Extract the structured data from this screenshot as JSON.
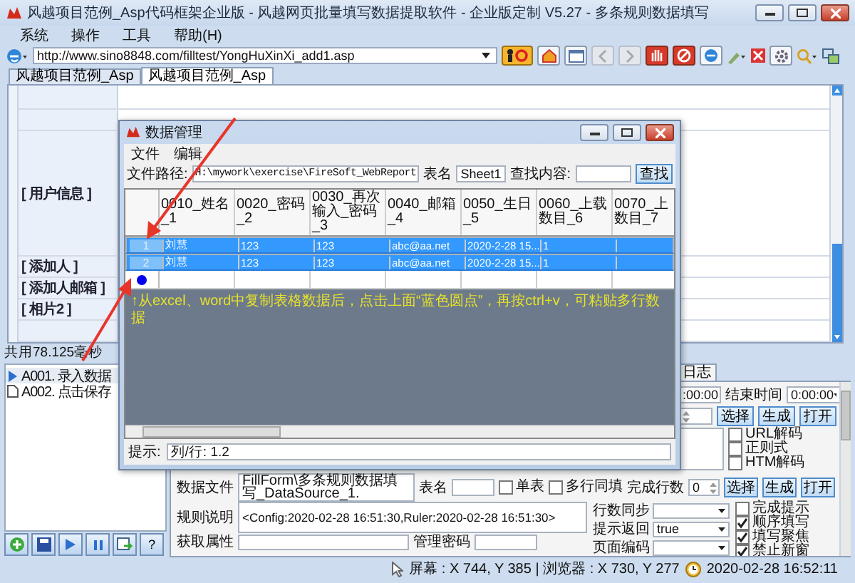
{
  "window": {
    "title": "风越项目范例_Asp代码框架企业版 - 风越网页批量填写数据提取软件 - 企业版定制 V5.27 - 多条规则数据填写"
  },
  "menu": [
    "系统",
    "操作",
    "工具",
    "帮助(H)"
  ],
  "address_bar": {
    "url": "http://www.sino8848.com/filltest/YongHuXinXi_add1.asp"
  },
  "tabs": [
    {
      "label": "风越项目范例_Asp",
      "selected": false
    },
    {
      "label": "风越项目范例_Asp",
      "selected": true
    }
  ],
  "web_form": {
    "rows": [
      {
        "kind": "blank"
      },
      {
        "kind": "blank"
      },
      {
        "kind": "section",
        "label": "[ 用户信息 ]"
      },
      {
        "kind": "field",
        "label": "[ 添加人 ]"
      },
      {
        "kind": "field",
        "label": "[ 添加人邮箱 ]"
      },
      {
        "kind": "field",
        "label": "[ 相片2 ]"
      },
      {
        "kind": "blank"
      }
    ]
  },
  "timing": "共用78.125毫秒",
  "steps": [
    {
      "label": "A001. 录入数据",
      "selected": true,
      "kind": "play"
    },
    {
      "label": "A002. 点击保存",
      "selected": false,
      "kind": "doc"
    }
  ],
  "step_buttons": [
    {
      "kind": "add"
    },
    {
      "kind": "save"
    },
    {
      "kind": "play"
    },
    {
      "kind": "pause"
    },
    {
      "kind": "export"
    },
    {
      "kind": "help",
      "label": "?"
    }
  ],
  "settings": {
    "tab": "日志",
    "start_time": ":00:00",
    "end_time_label": "结束时间",
    "end_time": "0:00:00",
    "buttons_1": [
      "选择",
      "生成",
      "打开"
    ],
    "decode_options": [
      {
        "label": "URL解码",
        "checked": false
      },
      {
        "label": "正则式",
        "checked": false
      },
      {
        "label": "HTM解码",
        "checked": false
      }
    ],
    "data_file_label": "数据文件",
    "data_file": "FillForm\\多条规则数据填写_DataSource_1.",
    "table_name_label": "表名",
    "row_options": [
      {
        "label": "单表",
        "checked": false
      },
      {
        "label": "多行同填",
        "checked": false
      }
    ],
    "done_rows_label": "完成行数",
    "done_rows": "0",
    "buttons_2": [
      "选择",
      "生成",
      "打开"
    ],
    "rule_label": "规则说明",
    "rule_text": "<Config:2020-02-28 16:51:30,Ruler:2020-02-28 16:51:30>",
    "sync_label": "行数同步",
    "return_label": "提示返回",
    "return_value": "true",
    "attr_label": "获取属性",
    "password_label": "管理密码",
    "encoding_label": "页面编码",
    "flags": [
      {
        "label": "完成提示",
        "checked": false
      },
      {
        "label": "顺序填写",
        "checked": true
      },
      {
        "label": "填写聚焦",
        "checked": true
      },
      {
        "label": "禁止新窗",
        "checked": true
      }
    ]
  },
  "dialog": {
    "title": "数据管理",
    "menu": [
      "文件",
      "编辑"
    ],
    "path_label": "文件路径:",
    "path": "H:\\mywork\\exercise\\FireSoft_WebReport",
    "sheet_label": "表名",
    "sheet": "Sheet1",
    "find_label": "查找内容:",
    "find_button": "查找",
    "columns": [
      [
        "0010_姓名",
        "_1"
      ],
      [
        "0020_密码",
        "_2"
      ],
      [
        "0030_再次",
        "输入_密码",
        "_3"
      ],
      [
        "0040_邮箱",
        "_4"
      ],
      [
        "0050_生日",
        "_5"
      ],
      [
        "0060_上载",
        "数目_6"
      ],
      [
        "0070_上",
        "数目_7"
      ]
    ],
    "rows": [
      {
        "kind": "data",
        "selected": true,
        "number": "1",
        "cells": [
          "刘慧",
          "123",
          "123",
          "abc@aa.net",
          "2020-2-28 15...",
          "1"
        ]
      },
      {
        "kind": "data",
        "selected": true,
        "number": "2",
        "cells": [
          "刘慧",
          "123",
          "123",
          "abc@aa.net",
          "2020-2-28 15...",
          "1"
        ]
      },
      {
        "kind": "new",
        "selected": false
      }
    ],
    "hint": "↑从excel、word中复制表格数据后，点击上面“蓝色圆点”，再按ctrl+v，可粘贴多行数据",
    "tip_label": "提示:",
    "tip": "列/行: 1.2"
  },
  "status_bar": {
    "coords": "屏幕 : X 744, Y 385 | 浏览器 : X 730, Y 277",
    "time": "2020-02-28 16:52:11"
  }
}
